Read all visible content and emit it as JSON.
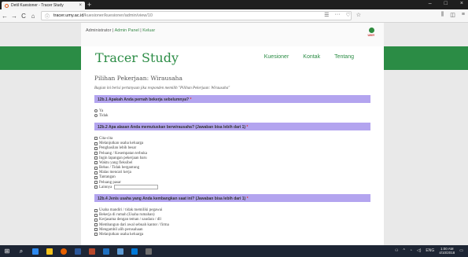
{
  "browser": {
    "tab_title": "Detil Kuesioner - Tracer Study",
    "tab_close": "×",
    "new_tab": "+",
    "url_host": "tracer.umy.ac.id",
    "url_path": "/kuesioner/kuesioner/admin/view/10",
    "url_prefix": "",
    "nav": {
      "back": "←",
      "forward": "→",
      "reload": "C",
      "home": "⌂"
    },
    "url_icons": [
      "☰",
      "···",
      "♡",
      "☆"
    ],
    "right_icons": [
      "⫼",
      "◫",
      "≡"
    ],
    "window_controls": [
      "–",
      "□",
      "×"
    ]
  },
  "admin": {
    "links": [
      "Administrator",
      "Admin Panel",
      "Keluar"
    ],
    "logo_text": "UMY"
  },
  "header": {
    "brand": "Tracer Study",
    "nav": [
      "Kuesioner",
      "Kontak",
      "Tentang"
    ]
  },
  "section": {
    "title": "Pilihan Pekerjaan: Wirausaha",
    "hint": "Bagian ini berisi pertanyaan jika responden memilih \"Pilihan Pekerjaan: Wirausaha\""
  },
  "questions": [
    {
      "label": "12b.1 Apakah Anda pernah bekerja sebelumnya?",
      "required_mark": "*",
      "type": "radio",
      "options": [
        "Ya",
        "Tidak"
      ]
    },
    {
      "label": "12b.2 Apa alasan Anda memutuskan berwirausaha? (Jawaban bisa lebih dari 1)",
      "required_mark": "*",
      "type": "checkbox",
      "options": [
        "Cita-cita",
        "Melanjutkan usaha keluarga",
        "Penghasilan lebih besar",
        "Peluang / Kesempatan terbuka",
        "Ingin lapangan pekerjaan baru",
        "Waktu yang fleksibel",
        "Bebas / Tidak bergantung",
        "Malas mencari kerja",
        "Tantangan",
        "Peluang pasar",
        "Lainnya"
      ]
    },
    {
      "label": "12b.4 Jenis usaha yang Anda kembangkan saat ini? (Jawaban bisa lebih dari 1)",
      "required_mark": "*",
      "type": "checkbox",
      "options": [
        "Usaha mandiri / tidak memiliki pegawai",
        "Bekerja di rumah (Usaha rumahan)",
        "Kerjasama dengan teman / saudara / dll",
        "Membangun dari awal sebuah kantor / firma",
        "Mengambil alih perusahaan",
        "Melanjutkan usaha keluarga"
      ]
    }
  ],
  "taskbar": {
    "time": "1:00 AM",
    "date": "4/10/2018",
    "lang": "ENG"
  }
}
